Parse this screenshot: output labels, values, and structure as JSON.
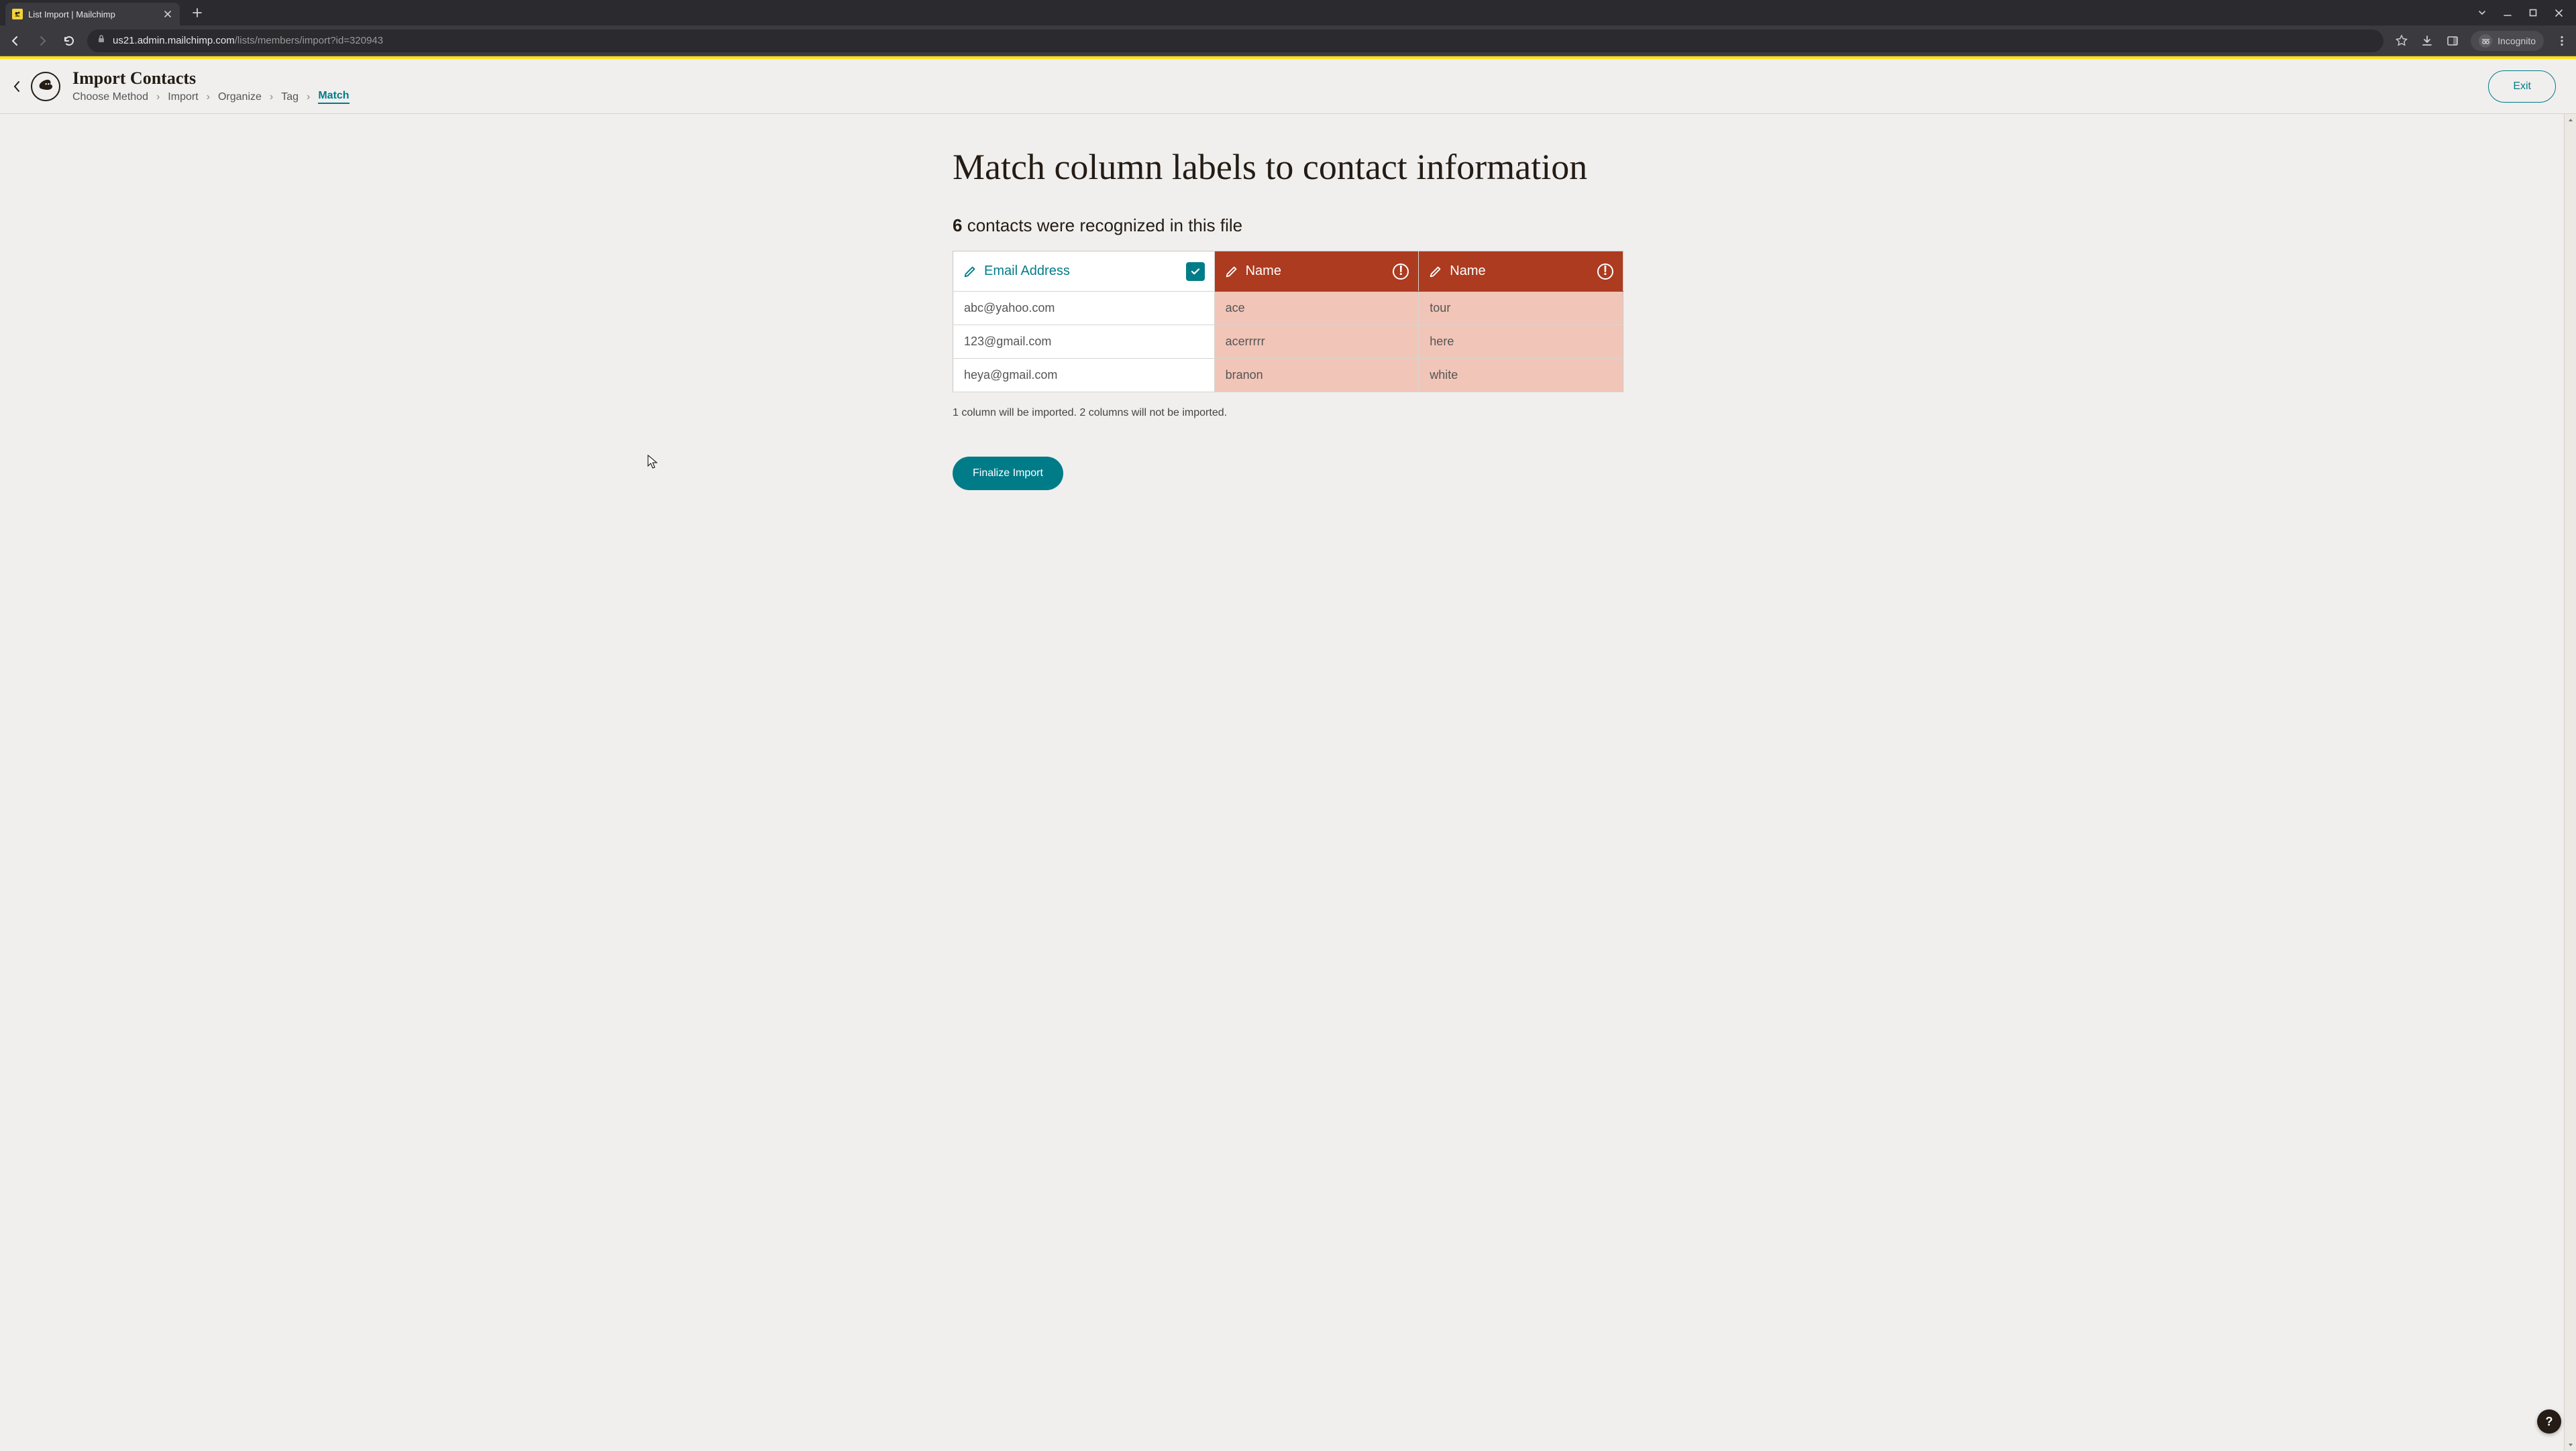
{
  "browser": {
    "tab_title": "List Import | Mailchimp",
    "url_host": "us21.admin.mailchimp.com",
    "url_path": "/lists/members/import?id=320943",
    "incognito_label": "Incognito"
  },
  "header": {
    "title": "Import Contacts",
    "breadcrumbs": [
      "Choose Method",
      "Import",
      "Organize",
      "Tag",
      "Match"
    ],
    "active_crumb_index": 4,
    "exit_label": "Exit"
  },
  "main": {
    "heading": "Match column labels to contact information",
    "recognized_count": "6",
    "recognized_suffix": " contacts were recognized in this file",
    "columns": [
      {
        "label": "Email Address",
        "status": "ok"
      },
      {
        "label": "Name",
        "status": "bad"
      },
      {
        "label": "Name",
        "status": "bad"
      }
    ],
    "rows": [
      [
        "abc@yahoo.com",
        "ace",
        "tour"
      ],
      [
        "123@gmail.com",
        "acerrrrr",
        "here"
      ],
      [
        "heya@gmail.com",
        "branon",
        "white"
      ]
    ],
    "summary_text": "1 column will be imported. 2 columns will not be imported.",
    "finalize_label": "Finalize Import"
  },
  "help_label": "?"
}
